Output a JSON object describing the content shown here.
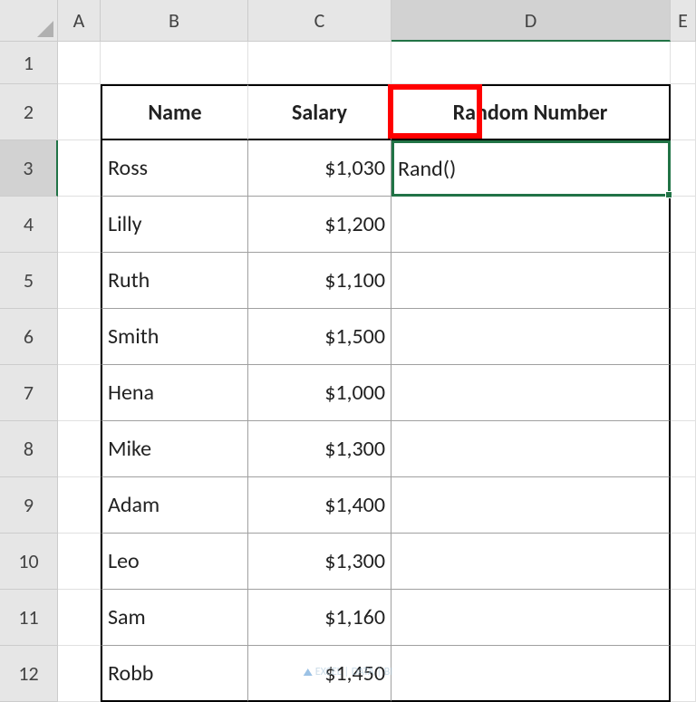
{
  "columns": [
    "A",
    "B",
    "C",
    "D",
    "E"
  ],
  "rows": [
    "1",
    "2",
    "3",
    "4",
    "5",
    "6",
    "7",
    "8",
    "9",
    "10",
    "11",
    "12"
  ],
  "active_column": "D",
  "active_row": "3",
  "headers": {
    "name": "Name",
    "salary": "Salary",
    "random": "Random Number"
  },
  "data": [
    {
      "name": "Ross",
      "salary": "$1,030"
    },
    {
      "name": "Lilly",
      "salary": "$1,200"
    },
    {
      "name": "Ruth",
      "salary": "$1,100"
    },
    {
      "name": "Smith",
      "salary": "$1,500"
    },
    {
      "name": "Hena",
      "salary": "$1,000"
    },
    {
      "name": "Mike",
      "salary": "$1,300"
    },
    {
      "name": "Adam",
      "salary": "$1,400"
    },
    {
      "name": "Leo",
      "salary": "$1,300"
    },
    {
      "name": "Sam",
      "salary": "$1,160"
    },
    {
      "name": "Robb",
      "salary": "$1,450"
    }
  ],
  "selected_cell_value": "Rand()",
  "watermark": "EXCEL | DATA | BI"
}
